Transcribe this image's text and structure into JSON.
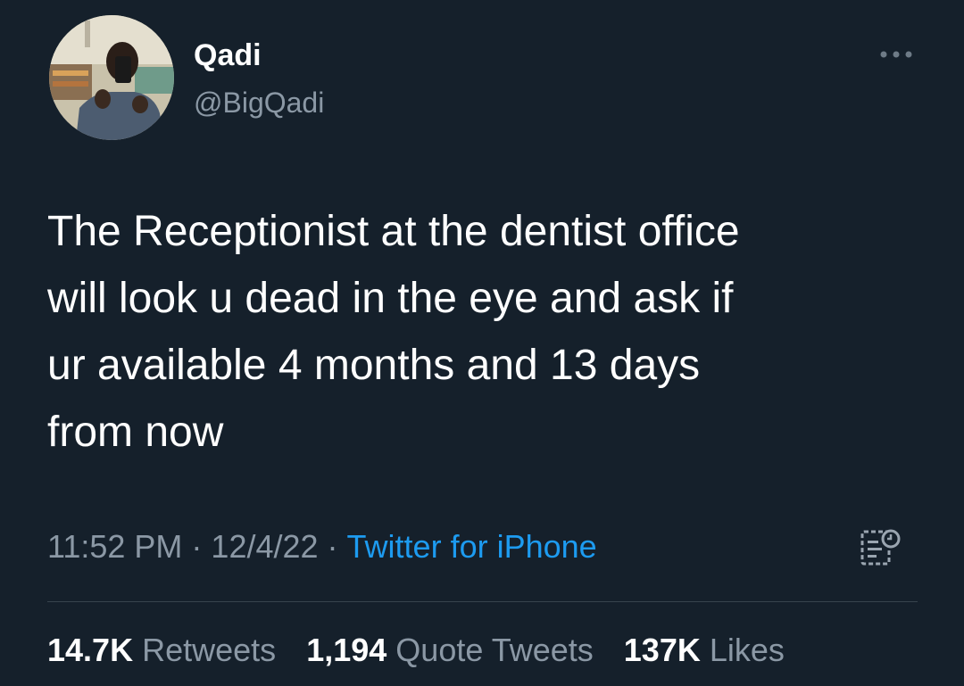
{
  "user": {
    "display_name": "Qadi",
    "handle": "@BigQadi"
  },
  "tweet": {
    "text_lines": [
      "The Receptionist at the dentist office",
      "will look u dead in the eye and ask if",
      "ur available 4 months and 13 days",
      "from now"
    ]
  },
  "meta": {
    "time": "11:52 PM",
    "separator": "·",
    "date": "12/4/22",
    "source": "Twitter for iPhone"
  },
  "stats": {
    "retweets_count": "14.7K",
    "retweets_label": "Retweets",
    "quotes_count": "1,194",
    "quotes_label": "Quote Tweets",
    "likes_count": "137K",
    "likes_label": "Likes"
  },
  "icons": {
    "more": "more-horizontal-icon",
    "analytics": "tweet-analytics-icon"
  },
  "colors": {
    "background": "#15202b",
    "text_primary": "#ffffff",
    "text_secondary": "#8b98a5",
    "link": "#1d9bf0",
    "divider": "#38444d"
  }
}
